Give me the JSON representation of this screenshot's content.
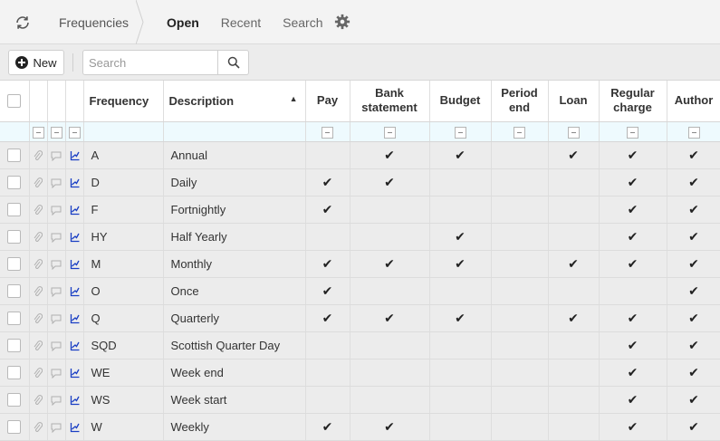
{
  "header": {
    "breadcrumb": "Frequencies",
    "tabs": [
      {
        "label": "Open",
        "active": true
      },
      {
        "label": "Recent",
        "active": false
      },
      {
        "label": "Search",
        "active": false
      }
    ]
  },
  "toolbar": {
    "new_label": "New",
    "search_placeholder": "Search",
    "search_value": ""
  },
  "grid": {
    "columns": [
      "Frequency",
      "Description",
      "Pay",
      "Bank statement",
      "Budget",
      "Period end",
      "Loan",
      "Regular charge",
      "Author"
    ],
    "sort": {
      "column": "Description",
      "direction": "ascending"
    },
    "rows": [
      {
        "code": "A",
        "description": "Annual",
        "pay": false,
        "bank": true,
        "budget": true,
        "period_end": false,
        "loan": true,
        "regular": true,
        "author": true
      },
      {
        "code": "D",
        "description": "Daily",
        "pay": true,
        "bank": true,
        "budget": false,
        "period_end": false,
        "loan": false,
        "regular": true,
        "author": true
      },
      {
        "code": "F",
        "description": "Fortnightly",
        "pay": true,
        "bank": false,
        "budget": false,
        "period_end": false,
        "loan": false,
        "regular": true,
        "author": true
      },
      {
        "code": "HY",
        "description": "Half Yearly",
        "pay": false,
        "bank": false,
        "budget": true,
        "period_end": false,
        "loan": false,
        "regular": true,
        "author": true
      },
      {
        "code": "M",
        "description": "Monthly",
        "pay": true,
        "bank": true,
        "budget": true,
        "period_end": false,
        "loan": true,
        "regular": true,
        "author": true
      },
      {
        "code": "O",
        "description": "Once",
        "pay": true,
        "bank": false,
        "budget": false,
        "period_end": false,
        "loan": false,
        "regular": false,
        "author": true
      },
      {
        "code": "Q",
        "description": "Quarterly",
        "pay": true,
        "bank": true,
        "budget": true,
        "period_end": false,
        "loan": true,
        "regular": true,
        "author": true
      },
      {
        "code": "SQD",
        "description": "Scottish Quarter Day",
        "pay": false,
        "bank": false,
        "budget": false,
        "period_end": false,
        "loan": false,
        "regular": true,
        "author": true
      },
      {
        "code": "WE",
        "description": "Week end",
        "pay": false,
        "bank": false,
        "budget": false,
        "period_end": false,
        "loan": false,
        "regular": true,
        "author": true
      },
      {
        "code": "WS",
        "description": "Week start",
        "pay": false,
        "bank": false,
        "budget": false,
        "period_end": false,
        "loan": false,
        "regular": true,
        "author": true
      },
      {
        "code": "W",
        "description": "Weekly",
        "pay": true,
        "bank": true,
        "budget": false,
        "period_end": false,
        "loan": false,
        "regular": true,
        "author": true
      }
    ],
    "check_glyph": "✔",
    "row_icons": [
      "paperclip-icon",
      "comment-icon",
      "chart-icon"
    ]
  },
  "colors": {
    "chart_icon": "#1a3fc4",
    "muted_icon": "#b0b0b0",
    "filter_row": "#eefafe"
  }
}
